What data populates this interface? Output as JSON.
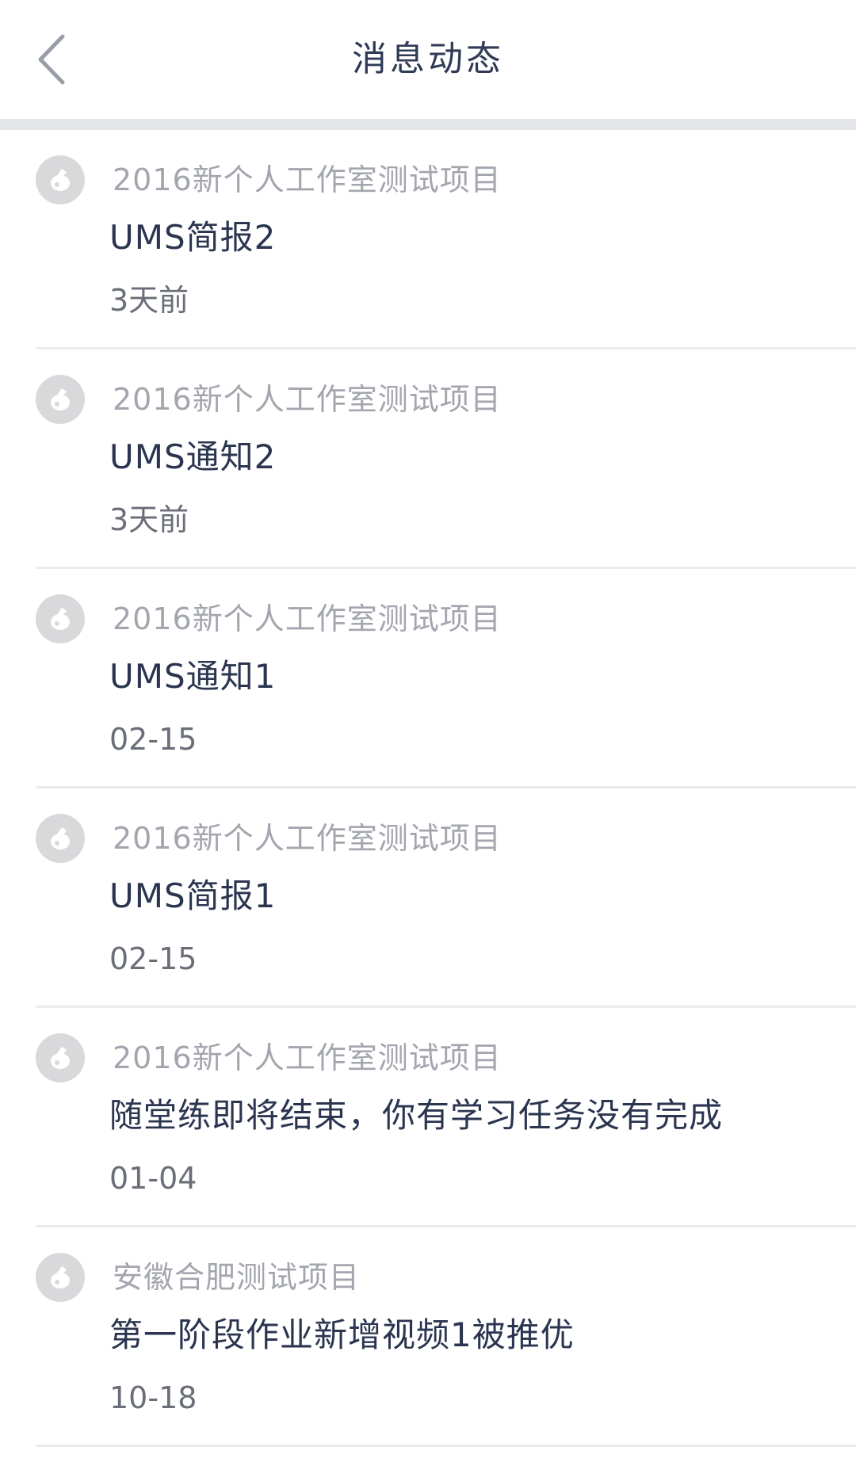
{
  "header": {
    "title": "消息动态",
    "back_icon": "chevron-left-icon"
  },
  "messages": [
    {
      "project": "2016新个人工作室测试项目",
      "title": "UMS简报2",
      "time": "3天前"
    },
    {
      "project": "2016新个人工作室测试项目",
      "title": "UMS通知2",
      "time": "3天前"
    },
    {
      "project": "2016新个人工作室测试项目",
      "title": "UMS通知1",
      "time": "02-15"
    },
    {
      "project": "2016新个人工作室测试项目",
      "title": "UMS简报1",
      "time": "02-15"
    },
    {
      "project": "2016新个人工作室测试项目",
      "title": "随堂练即将结束，你有学习任务没有完成",
      "time": "01-04"
    },
    {
      "project": "安徽合肥测试项目",
      "title": "第一阶段作业新增视频1被推优",
      "time": "10-18"
    }
  ],
  "colors": {
    "title": "#2b3550",
    "project": "#a3a6ae",
    "time": "#6a6e78",
    "avatar": "#d9d9db",
    "header_divider": "#e3e5e9"
  }
}
